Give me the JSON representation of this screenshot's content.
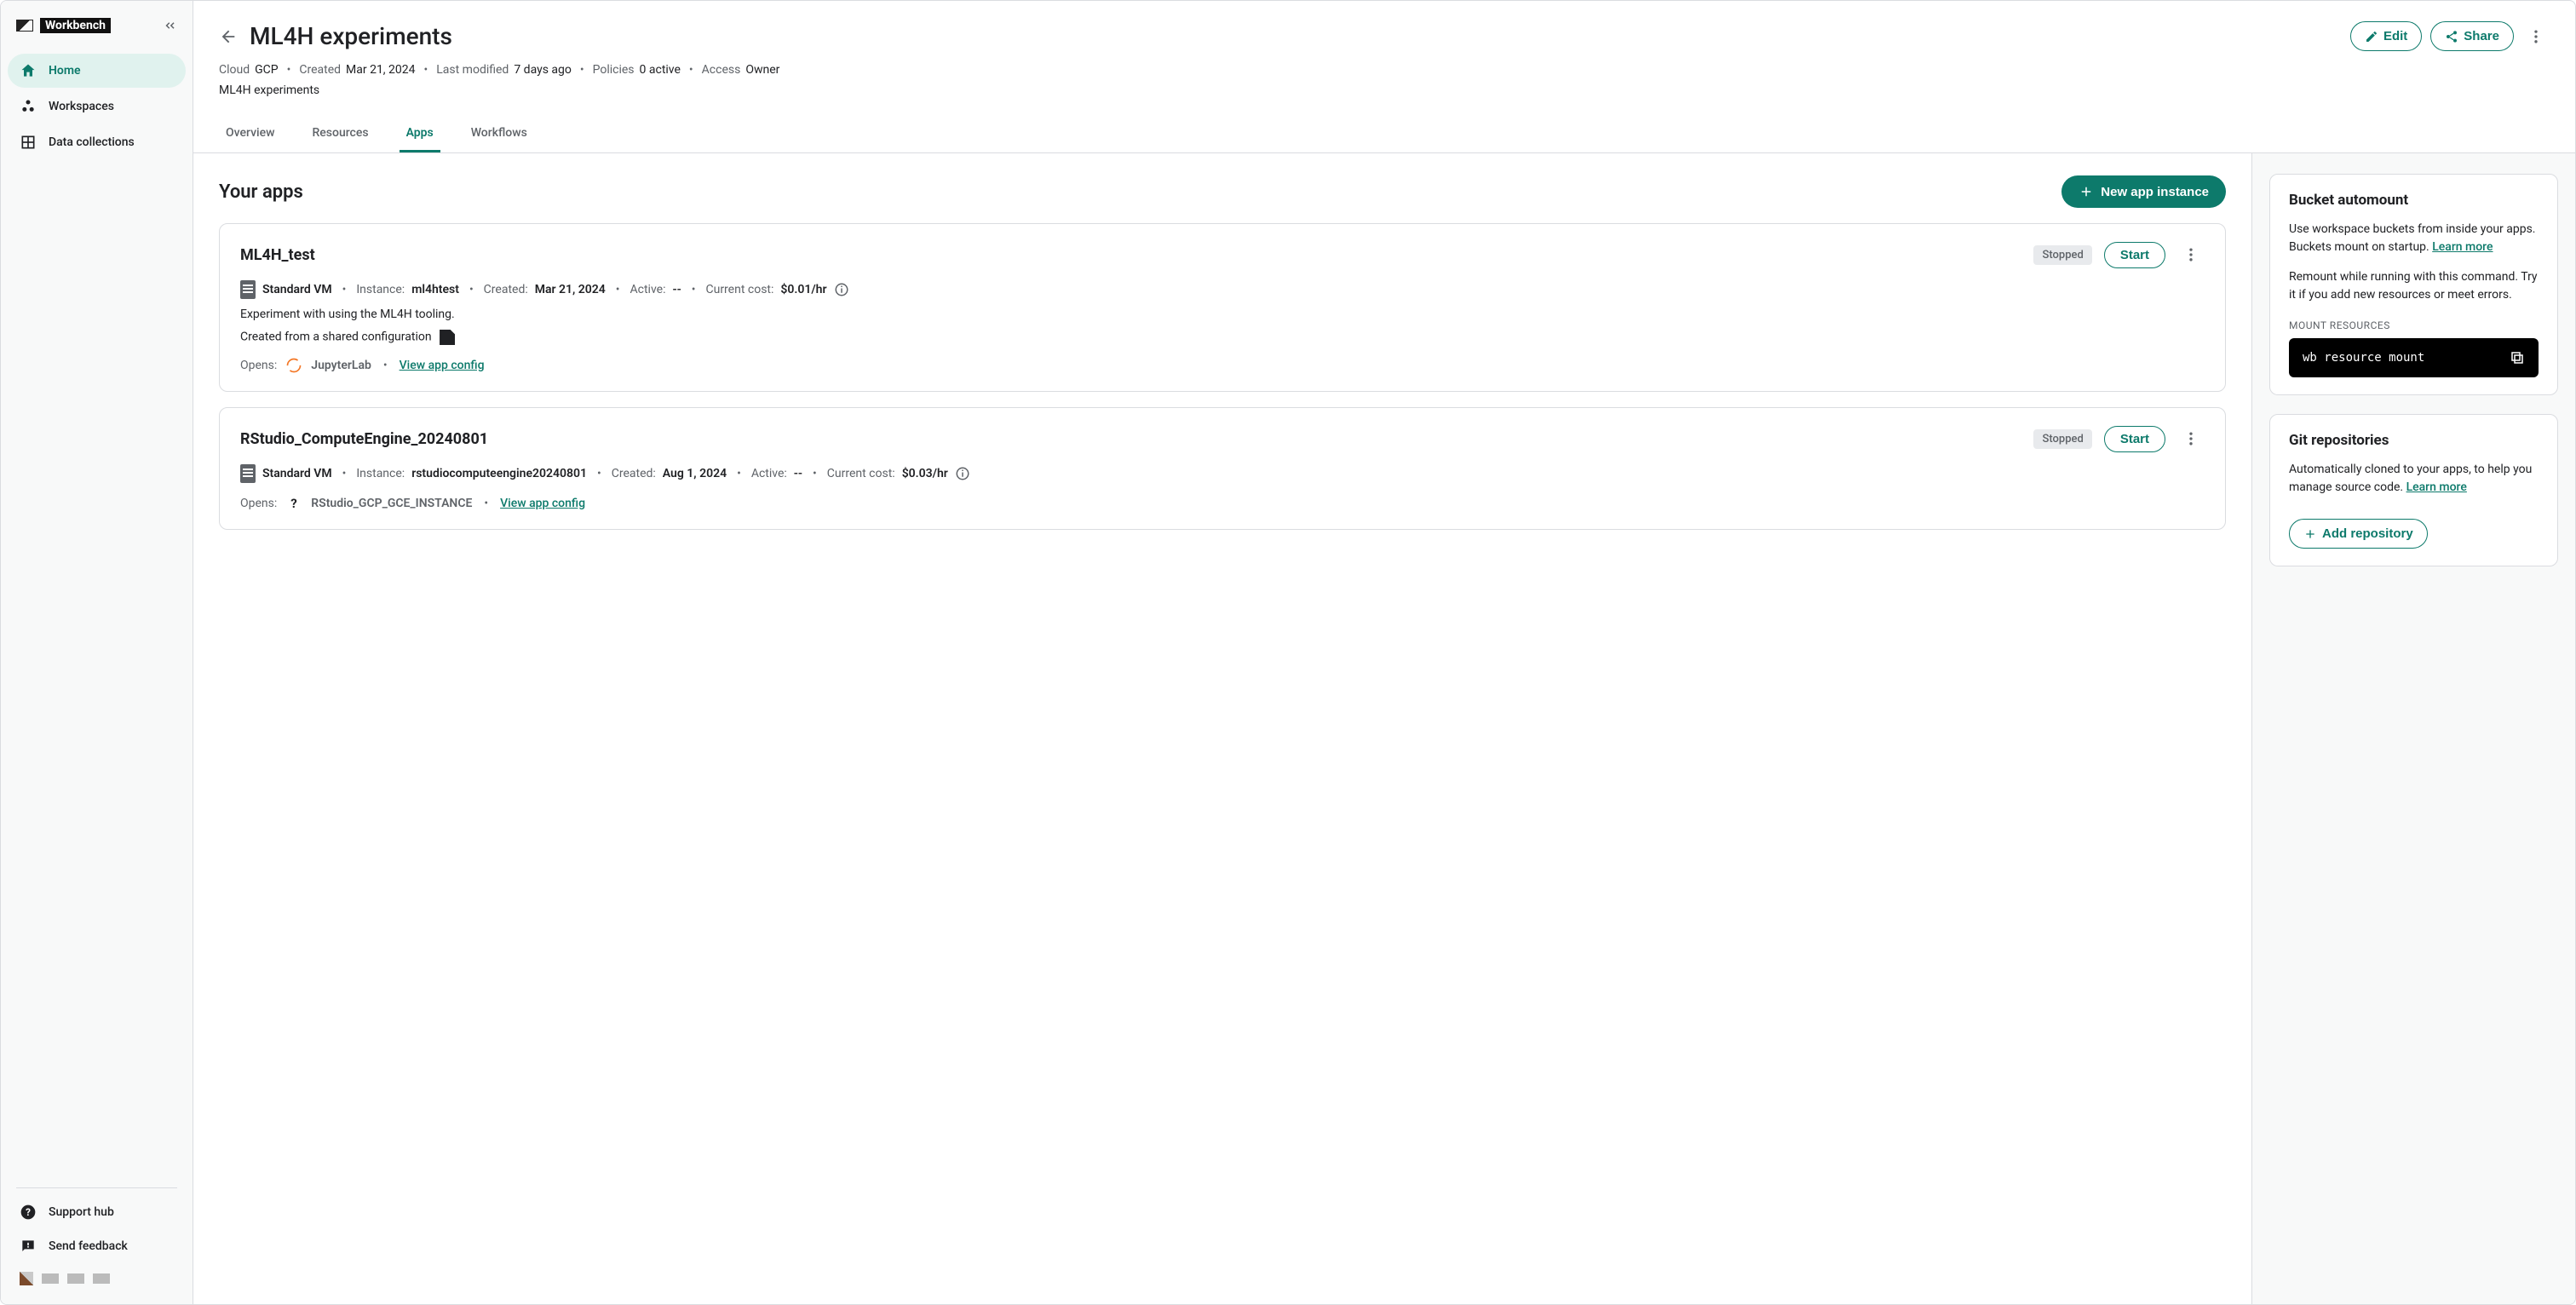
{
  "brand": {
    "name": "Workbench"
  },
  "sidebar": {
    "items": [
      {
        "label": "Home"
      },
      {
        "label": "Workspaces"
      },
      {
        "label": "Data collections"
      }
    ],
    "footer": [
      {
        "label": "Support hub"
      },
      {
        "label": "Send feedback"
      }
    ]
  },
  "header": {
    "title": "ML4H experiments",
    "edit": "Edit",
    "share": "Share",
    "meta": {
      "cloud_label": "Cloud",
      "cloud_value": "GCP",
      "created_label": "Created",
      "created_value": "Mar 21, 2024",
      "modified_label": "Last modified",
      "modified_value": "7 days ago",
      "policies_label": "Policies",
      "policies_value": "0 active",
      "access_label": "Access",
      "access_value": "Owner"
    },
    "description": "ML4H experiments",
    "tabs": [
      "Overview",
      "Resources",
      "Apps",
      "Workflows"
    ],
    "active_tab": "Apps"
  },
  "apps": {
    "section_title": "Your apps",
    "new_button": "New app instance",
    "list": [
      {
        "name": "ML4H_test",
        "status": "Stopped",
        "start": "Start",
        "vm_type": "Standard VM",
        "instance_label": "Instance:",
        "instance_value": "ml4htest",
        "created_label": "Created:",
        "created_value": "Mar 21, 2024",
        "active_label": "Active:",
        "active_value": "--",
        "cost_label": "Current cost:",
        "cost_value": "$0.01/hr",
        "description": "Experiment with using the ML4H tooling.",
        "config_note": "Created from a shared configuration",
        "opens_label": "Opens:",
        "opens_app": "JupyterLab",
        "view_config": "View app config"
      },
      {
        "name": "RStudio_ComputeEngine_20240801",
        "status": "Stopped",
        "start": "Start",
        "vm_type": "Standard VM",
        "instance_label": "Instance:",
        "instance_value": "rstudiocomputeengine20240801",
        "created_label": "Created:",
        "created_value": "Aug 1, 2024",
        "active_label": "Active:",
        "active_value": "--",
        "cost_label": "Current cost:",
        "cost_value": "$0.03/hr",
        "opens_label": "Opens:",
        "opens_app": "RStudio_GCP_GCE_INSTANCE",
        "view_config": "View app config"
      }
    ]
  },
  "right": {
    "bucket": {
      "title": "Bucket automount",
      "p1": "Use workspace buckets from inside your apps. Buckets mount on startup. ",
      "learn": "Learn more",
      "p2": "Remount while running with this command. Try it if you add new resources or meet errors.",
      "mount_label": "MOUNT RESOURCES",
      "command": "wb resource mount"
    },
    "git": {
      "title": "Git repositories",
      "p1": "Automatically cloned to your apps, to help you manage source code. ",
      "learn": "Learn more",
      "add_btn": "Add repository"
    }
  }
}
